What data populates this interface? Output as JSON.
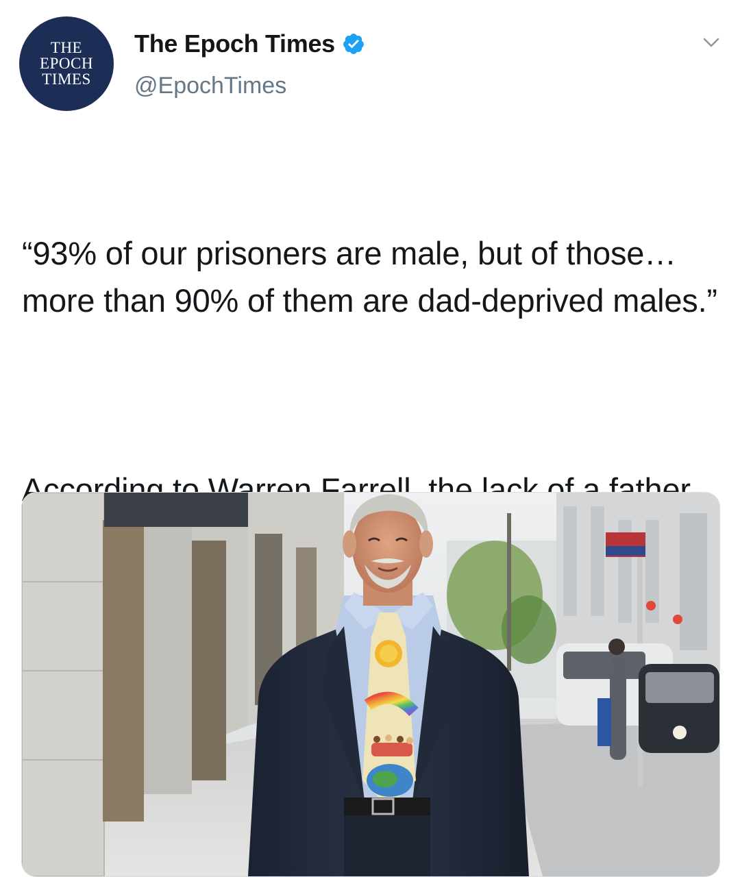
{
  "tweet": {
    "avatar": {
      "logo_text": "THE\nEPOCH\nTIMES",
      "background": "#1c2e55"
    },
    "author": {
      "display_name": "The Epoch Times",
      "handle": "@EpochTimes",
      "verified": true,
      "verified_icon": "verified-badge-icon",
      "verified_color": "#1da1f2"
    },
    "menu_icon": "chevron-down-icon",
    "text": {
      "paragraph_1": "“93% of our prisoners are male, but of those…more than 90% of them are dad-deprived males.”",
      "paragraph_2": "According to Warren Farrell, the lack of a father figure in the home is the greatest predictor of what he calls “the boy crisis.”"
    },
    "media": {
      "kind": "photo"
    }
  },
  "colors": {
    "text": "#14171a",
    "secondary_text": "#657786",
    "background": "#ffffff"
  }
}
